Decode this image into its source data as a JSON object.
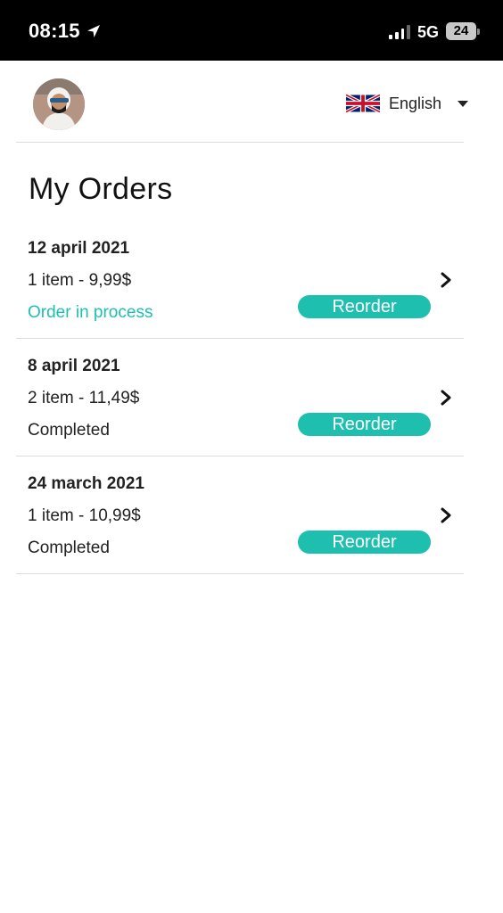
{
  "status_bar": {
    "time": "08:15",
    "network": "5G",
    "battery": "24"
  },
  "header": {
    "language": "English",
    "flag_icon": "uk-flag-icon",
    "caret_icon": "caret-down-icon"
  },
  "page": {
    "title": "My Orders"
  },
  "orders": [
    {
      "date": "12 april 2021",
      "summary": "1 item - 9,99$",
      "status": "Order in process",
      "status_active": true,
      "reorder_label": "Reorder"
    },
    {
      "date": "8 april 2021",
      "summary": "2 item - 11,49$",
      "status": "Completed",
      "status_active": false,
      "reorder_label": "Reorder"
    },
    {
      "date": "24 march 2021",
      "summary": "1 item - 10,99$",
      "status": "Completed",
      "status_active": false,
      "reorder_label": "Reorder"
    }
  ],
  "colors": {
    "accent": "#1fbfb0",
    "status_bar_bg": "#000000",
    "divider": "#dcdcdc"
  }
}
